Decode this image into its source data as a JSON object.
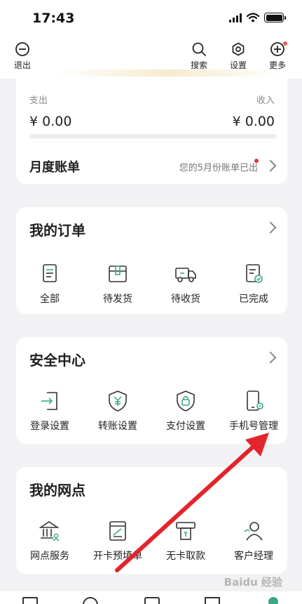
{
  "status_bar": {
    "time": "17:43"
  },
  "topnav": {
    "logout_label": "退出",
    "search_label": "搜索",
    "settings_label": "设置",
    "more_label": "更多"
  },
  "summary": {
    "expense_label": "支出",
    "income_label": "收入",
    "expense_amount": "¥ 0.00",
    "income_amount": "¥ 0.00",
    "balance_fraction": 1.0,
    "monthly_bill_label": "月度账单",
    "monthly_bill_note": "您的5月份账单已出"
  },
  "orders": {
    "title": "我的订单",
    "items": [
      {
        "label": "全部",
        "icon": "document-list-icon"
      },
      {
        "label": "待发货",
        "icon": "package-box-icon"
      },
      {
        "label": "待收货",
        "icon": "delivery-truck-icon"
      },
      {
        "label": "已完成",
        "icon": "completed-document-icon"
      }
    ]
  },
  "security": {
    "title": "安全中心",
    "items": [
      {
        "label": "登录设置",
        "icon": "login-icon"
      },
      {
        "label": "转账设置",
        "icon": "yuan-shield-icon"
      },
      {
        "label": "支付设置",
        "icon": "payment-lock-shield-icon"
      },
      {
        "label": "手机号管理",
        "icon": "phone-settings-icon"
      }
    ]
  },
  "outlets": {
    "title": "我的网点",
    "items": [
      {
        "label": "网点服务",
        "icon": "bank-outlet-icon"
      },
      {
        "label": "开卡预填单",
        "icon": "card-form-icon"
      },
      {
        "label": "无卡取款",
        "icon": "atm-cash-icon"
      },
      {
        "label": "客户经理",
        "icon": "manager-person-icon"
      }
    ]
  },
  "watermark": "Baidu 经验",
  "colors": {
    "accent": "#3aa982",
    "annotation_arrow": "#e3242b",
    "notification_dot": "#e3342f"
  }
}
